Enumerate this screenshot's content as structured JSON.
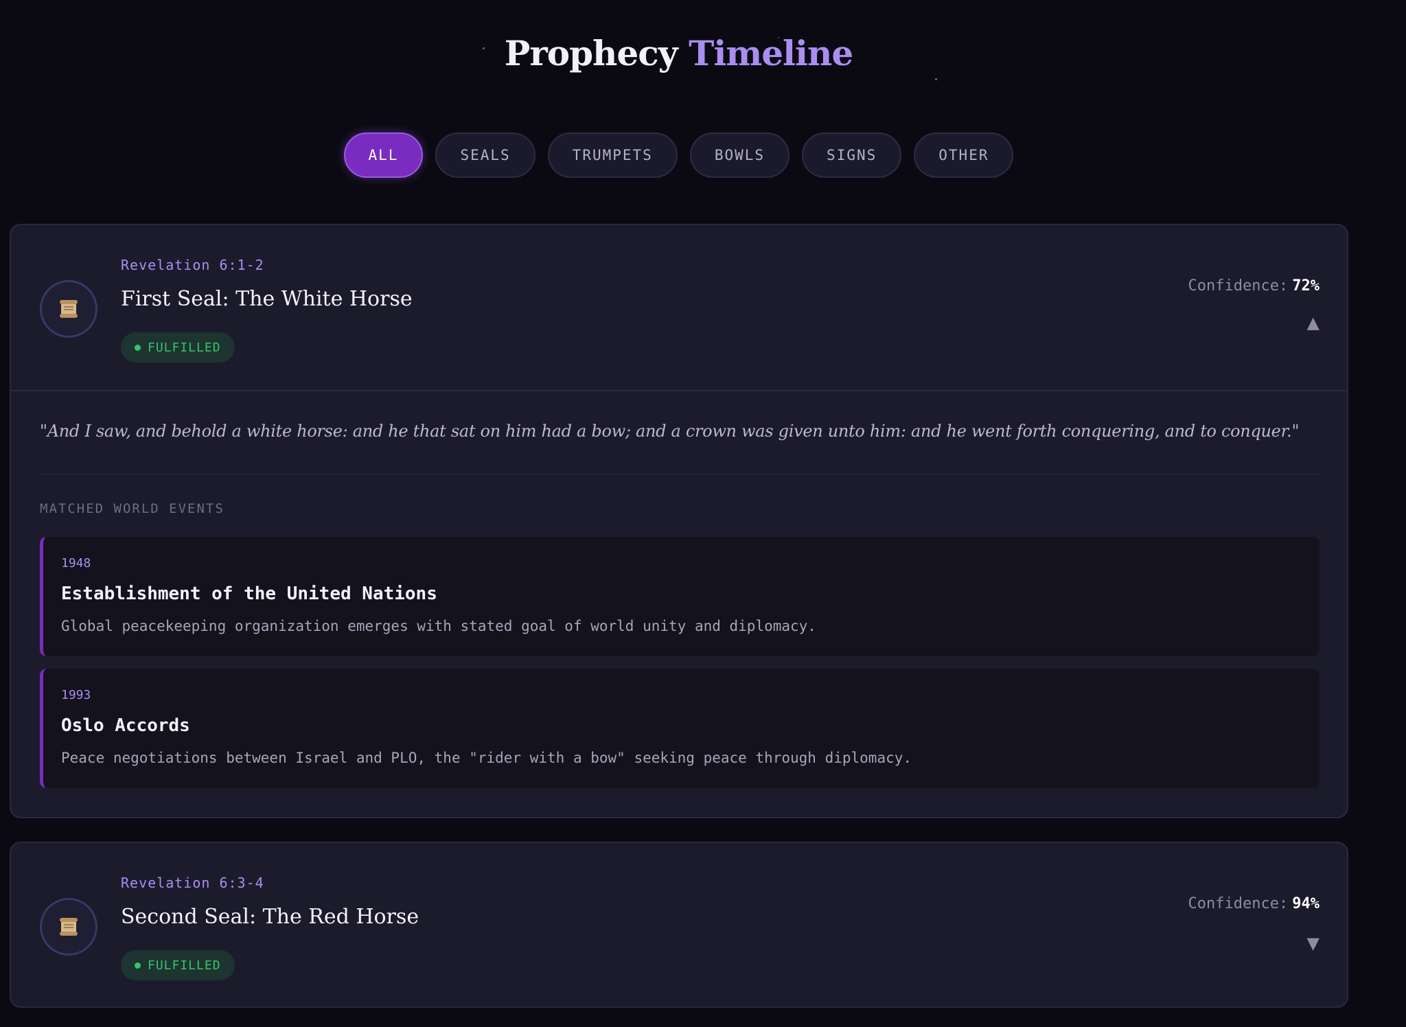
{
  "header": {
    "title_part1": "Prophecy",
    "title_part2": "Timeline"
  },
  "filters": [
    {
      "label": "ALL",
      "active": true
    },
    {
      "label": "SEALS",
      "active": false
    },
    {
      "label": "TRUMPETS",
      "active": false
    },
    {
      "label": "BOWLS",
      "active": false
    },
    {
      "label": "SIGNS",
      "active": false
    },
    {
      "label": "OTHER",
      "active": false
    }
  ],
  "prophecies": [
    {
      "reference": "Revelation 6:1-2",
      "title": "First Seal: The White Horse",
      "status": "FULFILLED",
      "confidence_label": "Confidence:",
      "confidence_value": "72%",
      "expanded": true,
      "icon": "scroll-icon",
      "quote": "\"And I saw, and behold a white horse: and he that sat on him had a bow; and a crown was given unto him: and he went forth conquering, and to conquer.\"",
      "matched_label": "MATCHED WORLD EVENTS",
      "events": [
        {
          "year": "1948",
          "title": "Establishment of the United Nations",
          "description": "Global peacekeeping organization emerges with stated goal of world unity and diplomacy."
        },
        {
          "year": "1993",
          "title": "Oslo Accords",
          "description": "Peace negotiations between Israel and PLO, the \"rider with a bow\" seeking peace through diplomacy."
        }
      ]
    },
    {
      "reference": "Revelation 6:3-4",
      "title": "Second Seal: The Red Horse",
      "status": "FULFILLED",
      "confidence_label": "Confidence:",
      "confidence_value": "94%",
      "expanded": false,
      "icon": "scroll-icon"
    }
  ],
  "icons": {
    "collapse": "chevron-up-icon",
    "expand": "chevron-down-icon"
  },
  "colors": {
    "accent": "#7a2bc0",
    "accent_light": "#a98ef0",
    "fulfilled": "#36c36a",
    "background": "#0b0a12",
    "card": "#1c1b2c"
  }
}
